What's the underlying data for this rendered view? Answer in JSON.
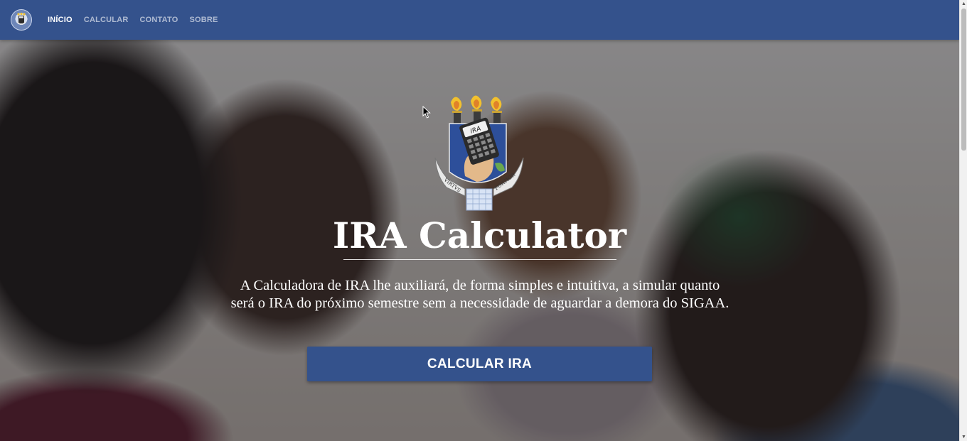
{
  "nav": {
    "links": [
      {
        "label": "INÍCIO",
        "active": true
      },
      {
        "label": "CALCULAR",
        "active": false
      },
      {
        "label": "CONTATO",
        "active": false
      },
      {
        "label": "SOBRE",
        "active": false
      }
    ]
  },
  "hero": {
    "title": "IRA Calculator",
    "description_line1": "A Calculadora de IRA lhe auxiliará, de forma simples e intuitiva, a simular quanto",
    "description_line2": "será o IRA do próximo semestre sem a necessidade de aguardar a demora do SIGAA.",
    "button_label": "CALCULAR IRA"
  },
  "emblem": {
    "calculator_display": "IRA",
    "motto_left": "VIRTVS",
    "motto_right": "FORTIOR"
  },
  "colors": {
    "brand": "#34528c",
    "text_on_dark": "#ffffff"
  }
}
